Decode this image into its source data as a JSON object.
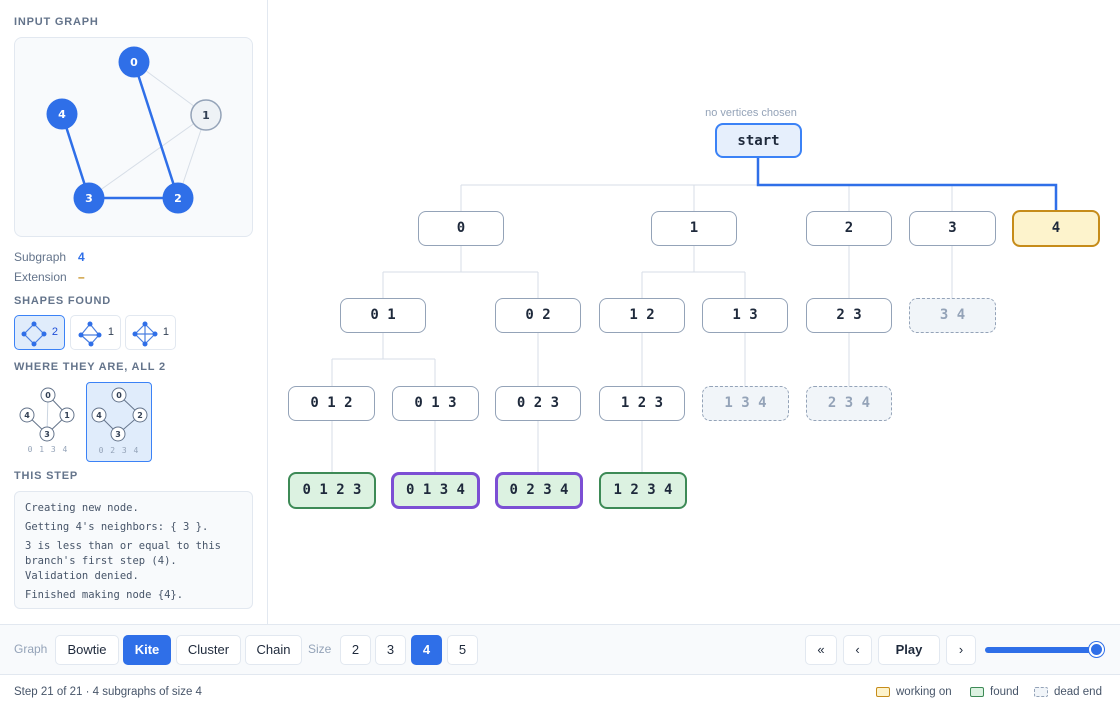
{
  "sidebar": {
    "input_graph_title": "INPUT GRAPH",
    "graph_vertices": [
      "0",
      "1",
      "2",
      "3",
      "4"
    ],
    "subgraph_label": "Subgraph",
    "subgraph_value": "4",
    "extension_label": "Extension",
    "extension_value": "–",
    "shapes_found_title": "SHAPES FOUND",
    "shapes": [
      {
        "shape": "kite-icon",
        "count": "2",
        "selected": true
      },
      {
        "shape": "paw-icon",
        "count": "1"
      },
      {
        "shape": "diamond-icon",
        "count": "1"
      }
    ],
    "where_title": "WHERE THEY ARE, ALL 2",
    "occurrences": [
      {
        "vertices": [
          "0",
          "1",
          "3",
          "4"
        ],
        "label": "0 1 3 4"
      },
      {
        "vertices": [
          "0",
          "2",
          "3",
          "4"
        ],
        "label": "0 2 3 4",
        "selected": true
      }
    ],
    "this_step_title": "THIS STEP",
    "step_lines": [
      "Creating new node.",
      "Getting 4's neighbors: { 3 }.",
      "3 is less than or equal to this",
      "branch's first step (4).",
      "Validation denied.",
      "Finished making node {4}."
    ]
  },
  "tree": {
    "root_caption": "no vertices chosen",
    "root_label": "start",
    "level1": [
      "0",
      "1",
      "2",
      "3",
      "4"
    ],
    "level2": [
      "0 1",
      "0 2",
      "1 2",
      "1 3",
      "2 3",
      "3 4"
    ],
    "level3": [
      "0 1 2",
      "0 1 3",
      "0 2 3",
      "1 2 3",
      "1 3 4",
      "2 3 4"
    ],
    "level4": [
      "0 1 2 3",
      "0 1 3 4",
      "0 2 3 4",
      "1 2 3 4"
    ]
  },
  "controls": {
    "graph_label": "Graph",
    "graphs": [
      "Bowtie",
      "Kite",
      "Cluster",
      "Chain"
    ],
    "selected_graph": "Kite",
    "size_label": "Size",
    "sizes": [
      "2",
      "3",
      "4",
      "5"
    ],
    "selected_size": "4",
    "first_btn": "«",
    "prev_btn": "‹",
    "play_btn": "Play",
    "next_btn": "›",
    "progress": 1.0
  },
  "status": {
    "text": "Step 21 of 21 · 4 subgraphs of size 4",
    "legend": [
      {
        "label": "working on",
        "color": "#fdf3cc",
        "border": "#c68c1a"
      },
      {
        "label": "found",
        "color": "#dcf2e1",
        "border": "#3d8a56"
      },
      {
        "label": "dead end",
        "color": "#f1f5f9",
        "border": "#94a3b8"
      }
    ]
  },
  "colors": {
    "accent": "#2f6fe8",
    "working": "#c68c1a",
    "found": "#3d8a56",
    "selected_result": "#7c4fd4"
  }
}
